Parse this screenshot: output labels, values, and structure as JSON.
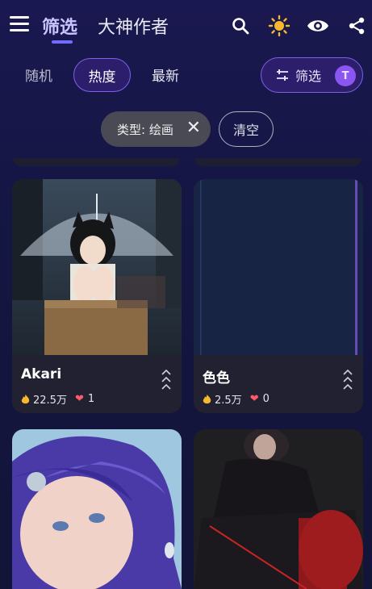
{
  "header": {
    "tabs": [
      "筛选",
      "大神作者"
    ],
    "active_tab": "筛选"
  },
  "sort": {
    "options": [
      "随机",
      "热度",
      "最新"
    ],
    "active": "热度"
  },
  "filter_button": {
    "label": "筛选",
    "badge": "T"
  },
  "chips": {
    "type_chip": "类型: 绘画",
    "clear_label": "清空"
  },
  "cards": [
    {
      "title": "Akari",
      "views": "22.5万",
      "likes": "1"
    },
    {
      "title": "色色",
      "views": "2.5万",
      "likes": "0"
    }
  ],
  "colors": {
    "accent": "#7b62e8",
    "background": "#141642",
    "heart": "#ff5a6a",
    "sun": "#f5b82e"
  },
  "icons": [
    "menu-icon",
    "search-icon",
    "sun-icon",
    "eye-icon",
    "share-icon",
    "sliders-icon",
    "close-icon",
    "fire-icon",
    "heart-icon",
    "chevrons-up-icon"
  ]
}
